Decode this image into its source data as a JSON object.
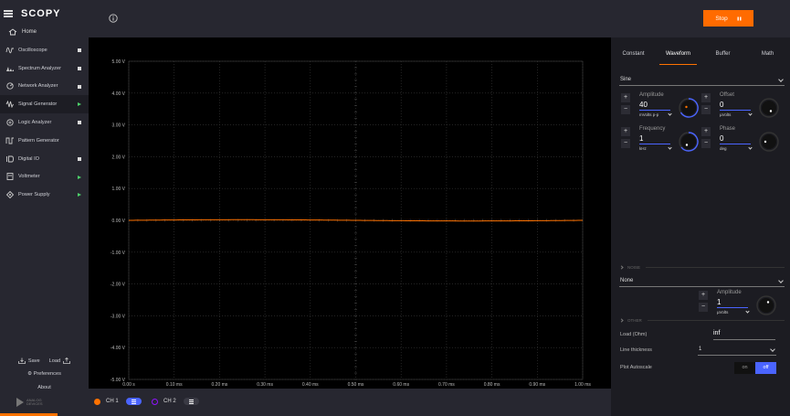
{
  "app": {
    "brand": "SCOPY"
  },
  "sidebar": {
    "home_label": "Home",
    "items": [
      {
        "label": "Oscilloscope",
        "icon": "oscilloscope-icon",
        "indicator": "square"
      },
      {
        "label": "Spectrum Analyzer",
        "icon": "spectrum-icon",
        "indicator": "square"
      },
      {
        "label": "Network Analyzer",
        "icon": "network-icon",
        "indicator": "square"
      },
      {
        "label": "Signal Generator",
        "icon": "signal-generator-icon",
        "indicator": "running",
        "active": true
      },
      {
        "label": "Logic Analyzer",
        "icon": "logic-icon",
        "indicator": "square"
      },
      {
        "label": "Pattern Generator",
        "icon": "pattern-icon",
        "indicator": "none"
      },
      {
        "label": "Digital IO",
        "icon": "digital-io-icon",
        "indicator": "square"
      },
      {
        "label": "Voltmeter",
        "icon": "voltmeter-icon",
        "indicator": "running"
      },
      {
        "label": "Power Supply",
        "icon": "power-icon",
        "indicator": "running"
      }
    ],
    "save_label": "Save",
    "load_label": "Load",
    "preferences_label": "Preferences",
    "about_label": "About",
    "logo_text_1": "ANALOG",
    "logo_text_2": "DEVICES"
  },
  "toolbar": {
    "stop_label": "Stop"
  },
  "colors": {
    "accent": "#ff7200",
    "blue": "#4a64ff",
    "ch2": "#9013fe",
    "running": "#4cd26a"
  },
  "plot": {
    "y_ticks": [
      "5.00 V",
      "4.00 V",
      "3.00 V",
      "2.00 V",
      "1.00 V",
      "0.00 V",
      "-1.00 V",
      "-2.00 V",
      "-3.00 V",
      "-4.00 V",
      "-5.00 V"
    ],
    "x_ticks": [
      "0.00 s",
      "0.10 ms",
      "0.20 ms",
      "0.30 ms",
      "0.40 ms",
      "0.50 ms",
      "0.60 ms",
      "0.70 ms",
      "0.80 ms",
      "0.90 ms",
      "1.00 ms"
    ],
    "signal_level": 0.0
  },
  "channels": {
    "ch1_label": "CH 1",
    "ch2_label": "CH 2"
  },
  "panel": {
    "tabs": [
      "Constant",
      "Waveform",
      "Buffer",
      "Math"
    ],
    "active_tab": 1,
    "waveform_type": "Sine",
    "amplitude": {
      "label": "Amplitude",
      "value": "40",
      "unit": "mVolts p-p"
    },
    "offset": {
      "label": "Offset",
      "value": "0",
      "unit": "µVolts"
    },
    "frequency": {
      "label": "Frequency",
      "value": "1",
      "unit": "kHz"
    },
    "phase": {
      "label": "Phase",
      "value": "0",
      "unit": "deg"
    },
    "noise_header": "NOISE",
    "noise_type": "None",
    "noise_amplitude": {
      "label": "Amplitude",
      "value": "1",
      "unit": "µVolts"
    },
    "other_header": "OTHER",
    "load_label": "Load (Ohm)",
    "load_value": "inf",
    "line_thickness_label": "Line thickness",
    "line_thickness_value": "1",
    "plot_autoscale_label": "Plot Autoscale",
    "switch_on": "on",
    "switch_off": "off"
  }
}
